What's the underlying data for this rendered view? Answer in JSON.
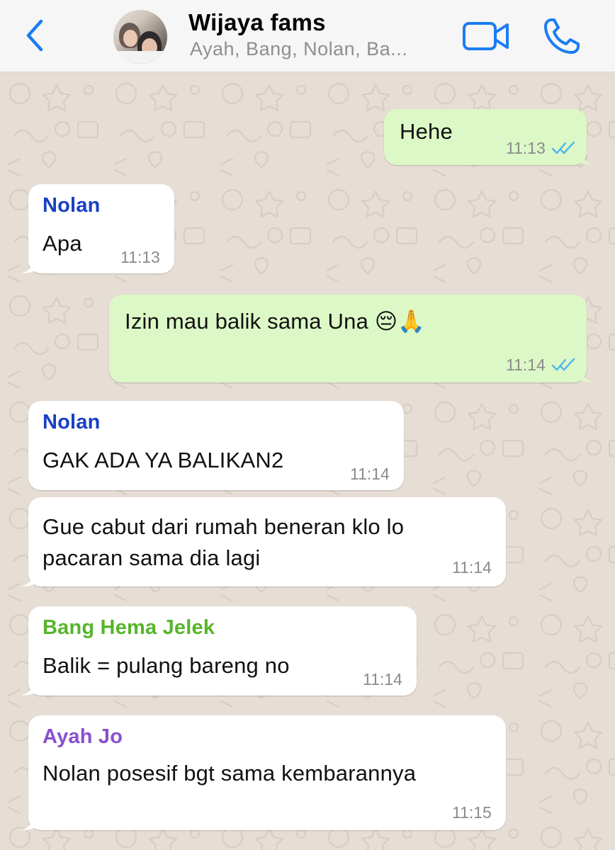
{
  "header": {
    "title": "Wijaya fams",
    "subtitle": "Ayah, Bang, Nolan, Ba...",
    "icons": {
      "back": "chevron-left-icon",
      "video": "video-camera-icon",
      "call": "phone-icon"
    },
    "accent_color": "#1a7cf5"
  },
  "messages": [
    {
      "direction": "out",
      "text": "Hehe",
      "time": "11:13",
      "status": "read"
    },
    {
      "direction": "in",
      "sender": "Nolan",
      "sender_color": "#1840c4",
      "text": "Apa",
      "time": "11:13"
    },
    {
      "direction": "out",
      "text": "Izin mau balik sama Una 😔🙏",
      "time": "11:14",
      "status": "read"
    },
    {
      "direction": "in",
      "sender": "Nolan",
      "sender_color": "#1840c4",
      "text": "GAK ADA YA BALIKAN2",
      "time": "11:14"
    },
    {
      "direction": "in",
      "lines": [
        "Gue cabut dari rumah beneran klo lo",
        "pacaran sama dia lagi"
      ],
      "time": "11:14"
    },
    {
      "direction": "in",
      "sender": "Bang Hema Jelek",
      "sender_color": "#57b52b",
      "text": "Balik = pulang bareng no",
      "time": "11:14"
    },
    {
      "direction": "in",
      "sender": "Ayah Jo",
      "sender_color": "#8a4fd0",
      "text": "Nolan posesif bgt sama kembarannya",
      "time": "11:15"
    }
  ],
  "colors": {
    "outgoing_bubble": "#dcf8c6",
    "incoming_bubble": "#ffffff",
    "read_ticks": "#4fb6ec",
    "wallpaper": "#e6ddd4"
  }
}
